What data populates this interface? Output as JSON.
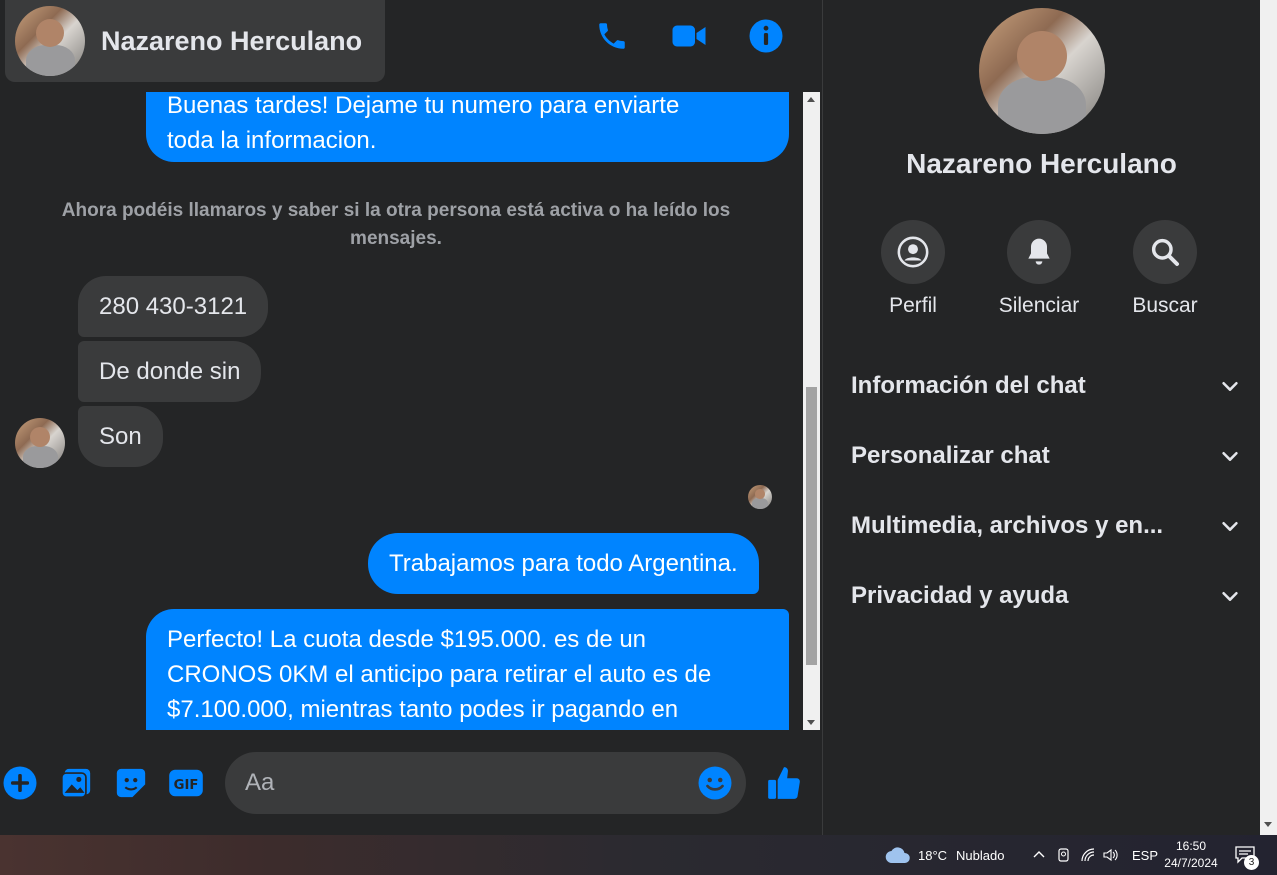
{
  "header": {
    "contact_name": "Nazareno Herculano",
    "icons": [
      "phone-icon",
      "video-icon",
      "info-icon"
    ]
  },
  "messages": {
    "out_1": [
      "Buenas tardes! Dejame tu numero para enviarte",
      "toda la informacion."
    ],
    "system_notice": "Ahora podéis llamaros y saber si la otra persona está activa o ha leído los mensajes.",
    "in_1": "280 430-3121",
    "in_2": "De donde sin",
    "in_3": "Son",
    "out_2": "Trabajamos para todo Argentina.",
    "out_3": [
      "Perfecto! La cuota desde $195.000. es de un",
      "CRONOS 0KM el anticipo para retirar el auto es de",
      "$7.100.000, mientras tanto podes ir pagando en"
    ]
  },
  "composer": {
    "placeholder": "Aa",
    "icons": [
      "plus-icon",
      "image-icon",
      "sticker-icon",
      "gif-icon",
      "emoji-icon",
      "thumbs-up-icon"
    ]
  },
  "panel": {
    "name": "Nazareno Herculano",
    "actions": {
      "profile": "Perfil",
      "mute": "Silenciar",
      "search": "Buscar"
    },
    "sections": {
      "chat_info": "Información del chat",
      "customize": "Personalizar chat",
      "media": "Multimedia, archivos y en...",
      "privacy": "Privacidad y ayuda"
    }
  },
  "taskbar": {
    "temperature": "18°C",
    "weather": "Nublado",
    "language": "ESP",
    "time": "16:50",
    "date": "24/7/2024",
    "notifications": "3"
  },
  "colors": {
    "accent": "#0084ff",
    "background": "#242526",
    "bubble_in": "#3a3b3c"
  }
}
